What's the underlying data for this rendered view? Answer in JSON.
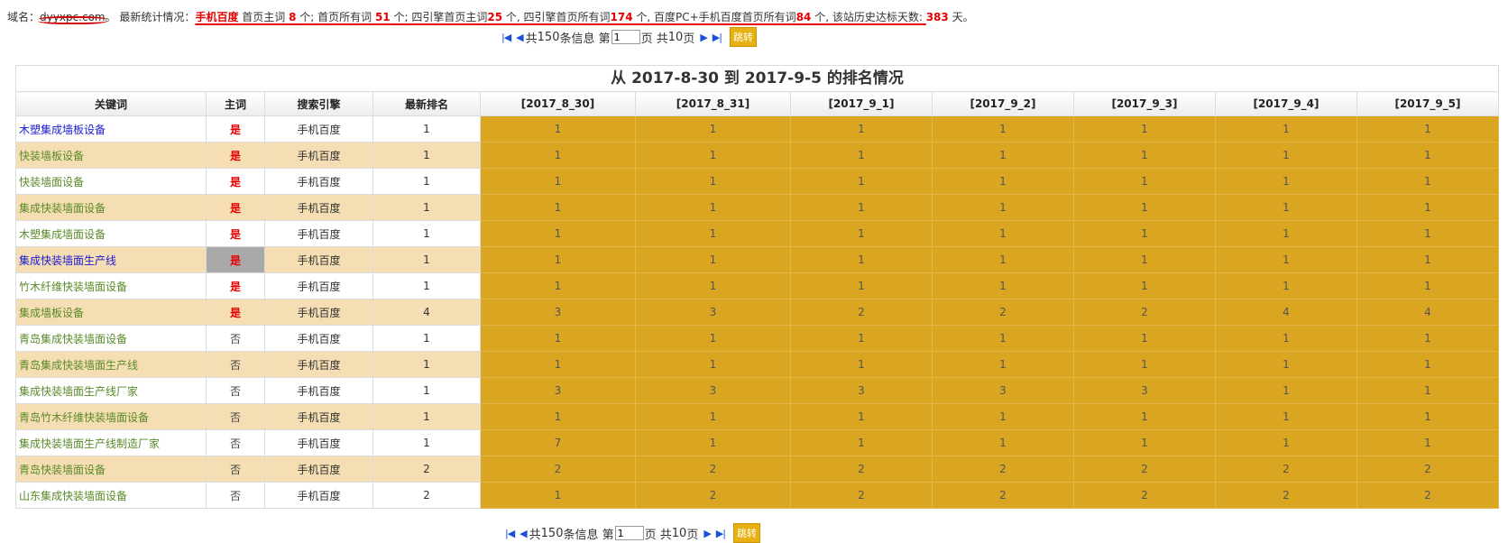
{
  "stats": {
    "label_domain": "域名：",
    "domain": "dyyxpc.com",
    "sep": "。 最新统计情况：",
    "engine": "手机百度",
    "t1": " 首页主词 ",
    "v1": "8",
    "t2": " 个; 首页所有词 ",
    "v2": "51",
    "t3": " 个; 四引擎首页主词",
    "v3": "25",
    "t4": " 个, 四引擎首页所有词",
    "v4": "174",
    "t5": " 个, 百度PC+手机百度首页所有词",
    "v5": "84",
    "t6": " 个, 该站历史达标天数: ",
    "v6": "383",
    "t7": " 天。"
  },
  "pager": {
    "total_prefix": " 共 ",
    "total": "150",
    "total_suffix": " 条信息 第",
    "page": "1",
    "pages_prefix": "页 共 ",
    "pages": "10",
    "pages_suffix": " 页",
    "first_icon": "first-page-icon",
    "prev_icon": "prev-page-icon",
    "next_icon": "next-page-icon",
    "last_icon": "last-page-icon",
    "go_label": "跳转"
  },
  "table": {
    "caption": "从 2017-8-30 到 2017-9-5 的排名情况",
    "headers": [
      "关键词",
      "主词",
      "搜索引擎",
      "最新排名",
      "[2017_8_30]",
      "[2017_8_31]",
      "[2017_9_1]",
      "[2017_9_2]",
      "[2017_9_3]",
      "[2017_9_4]",
      "[2017_9_5]"
    ],
    "rows": [
      {
        "keyword": "木塑集成墙板设备",
        "main": "是",
        "engine": "手机百度",
        "latest": "1",
        "ranks": [
          "1",
          "1",
          "1",
          "1",
          "1",
          "1",
          "1"
        ]
      },
      {
        "keyword": "快装墙板设备",
        "main": "是",
        "engine": "手机百度",
        "latest": "1",
        "ranks": [
          "1",
          "1",
          "1",
          "1",
          "1",
          "1",
          "1"
        ]
      },
      {
        "keyword": "快装墙面设备",
        "main": "是",
        "engine": "手机百度",
        "latest": "1",
        "ranks": [
          "1",
          "1",
          "1",
          "1",
          "1",
          "1",
          "1"
        ]
      },
      {
        "keyword": "集成快装墙面设备",
        "main": "是",
        "engine": "手机百度",
        "latest": "1",
        "ranks": [
          "1",
          "1",
          "1",
          "1",
          "1",
          "1",
          "1"
        ]
      },
      {
        "keyword": "木塑集成墙面设备",
        "main": "是",
        "engine": "手机百度",
        "latest": "1",
        "ranks": [
          "1",
          "1",
          "1",
          "1",
          "1",
          "1",
          "1"
        ]
      },
      {
        "keyword": "集成快装墙面生产线",
        "main": "是",
        "engine": "手机百度",
        "latest": "1",
        "ranks": [
          "1",
          "1",
          "1",
          "1",
          "1",
          "1",
          "1"
        ]
      },
      {
        "keyword": "竹木纤维快装墙面设备",
        "main": "是",
        "engine": "手机百度",
        "latest": "1",
        "ranks": [
          "1",
          "1",
          "1",
          "1",
          "1",
          "1",
          "1"
        ]
      },
      {
        "keyword": "集成墙板设备",
        "main": "是",
        "engine": "手机百度",
        "latest": "4",
        "ranks": [
          "3",
          "3",
          "2",
          "2",
          "2",
          "4",
          "4"
        ]
      },
      {
        "keyword": "青岛集成快装墙面设备",
        "main": "否",
        "engine": "手机百度",
        "latest": "1",
        "ranks": [
          "1",
          "1",
          "1",
          "1",
          "1",
          "1",
          "1"
        ]
      },
      {
        "keyword": "青岛集成快装墙面生产线",
        "main": "否",
        "engine": "手机百度",
        "latest": "1",
        "ranks": [
          "1",
          "1",
          "1",
          "1",
          "1",
          "1",
          "1"
        ]
      },
      {
        "keyword": "集成快装墙面生产线厂家",
        "main": "否",
        "engine": "手机百度",
        "latest": "1",
        "ranks": [
          "3",
          "3",
          "3",
          "3",
          "3",
          "1",
          "1"
        ]
      },
      {
        "keyword": "青岛竹木纤维快装墙面设备",
        "main": "否",
        "engine": "手机百度",
        "latest": "1",
        "ranks": [
          "1",
          "1",
          "1",
          "1",
          "1",
          "1",
          "1"
        ]
      },
      {
        "keyword": "集成快装墙面生产线制造厂家",
        "main": "否",
        "engine": "手机百度",
        "latest": "1",
        "ranks": [
          "7",
          "1",
          "1",
          "1",
          "1",
          "1",
          "1"
        ]
      },
      {
        "keyword": "青岛快装墙面设备",
        "main": "否",
        "engine": "手机百度",
        "latest": "2",
        "ranks": [
          "2",
          "2",
          "2",
          "2",
          "2",
          "2",
          "2"
        ]
      },
      {
        "keyword": "山东集成快装墙面设备",
        "main": "否",
        "engine": "手机百度",
        "latest": "2",
        "ranks": [
          "1",
          "2",
          "2",
          "2",
          "2",
          "2",
          "2"
        ]
      }
    ]
  },
  "colors": {
    "accent_red": "#e60000",
    "rank_gold": "#daa520",
    "row_stripe": "#f5deb3",
    "link_blue": "#1a1ad0",
    "link_green": "#5a8a2a",
    "highlight_grey": "#a9a9a9"
  }
}
